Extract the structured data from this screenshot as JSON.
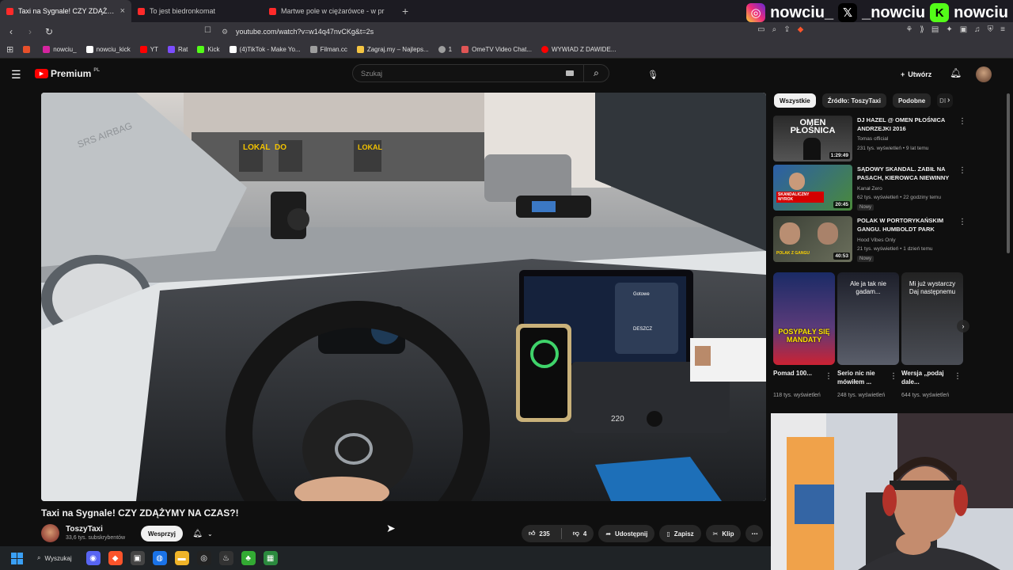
{
  "browser": {
    "tabs": [
      {
        "title": "Taxi na Sygnale! CZY ZDĄŻYM",
        "active": true
      },
      {
        "title": "To jest biedronkomat",
        "active": false
      },
      {
        "title": "Martwe pole w ciężarówce - w pr",
        "active": false
      }
    ],
    "close_glyph": "×",
    "new_tab_glyph": "+",
    "url": "youtube.com/watch?v=w14q47nvCKg&t=2s",
    "bookmarks": [
      {
        "label": "",
        "color": "#e8502b"
      },
      {
        "label": "nowciu_",
        "color": "#d6249f"
      },
      {
        "label": "nowciu_kick",
        "color": "#ffffff"
      },
      {
        "label": "YT",
        "color": "#ff0000"
      },
      {
        "label": "Rat",
        "color": "#7c4dff"
      },
      {
        "label": "Kick",
        "color": "#53fc18"
      },
      {
        "label": "(4)TikTok - Make Yo...",
        "color": "#ffffff"
      },
      {
        "label": "Filman.cc",
        "color": "#9e9e9e"
      },
      {
        "label": "Zagraj.my – Najleps...",
        "color": "#f5c542"
      },
      {
        "label": "1",
        "color": "#9e9e9e"
      },
      {
        "label": "OmeTV Video Chat...",
        "color": "#e05555"
      },
      {
        "label": "WYWIAD Z DAWIDE...",
        "color": "#ff0000"
      }
    ]
  },
  "socials": {
    "instagram": "nowciu_",
    "x": "_nowciu",
    "kick": "nowciu"
  },
  "youtube": {
    "logo_text": "Premium",
    "logo_region": "PL",
    "search_placeholder": "Szukaj",
    "create_label": "Utwórz"
  },
  "video": {
    "title": "Taxi na Sygnale! CZY ZDĄŻYMY NA CZAS?!",
    "channel": "ToszyTaxi",
    "subscribers": "33,6 tys. subskrybentów",
    "support_label": "Wesprzyj",
    "likes": "235",
    "dislikes": "4",
    "share_label": "Udostępnij",
    "save_label": "Zapisz",
    "clip_label": "Klip",
    "scene": {
      "shop_signs": [
        "LOKAL DO WYNAJĘCIA",
        "LOKAL DO WYNAJĘCIA"
      ],
      "screen_rain": "DESZCZ",
      "screen_ready": "Gotowe",
      "speedo": "220"
    }
  },
  "sidebar": {
    "chips": [
      "Wszystkie",
      "Źródło: ToszyTaxi",
      "Podobne",
      "Dl"
    ],
    "recommendations": [
      {
        "title": "DJ HAZEL @ OMEN PŁOŚNICA ANDRZEJKI 2016",
        "channel": "Tomas official",
        "meta": "231 tys. wyświetleń • 9 lat temu",
        "duration": "1:29:49",
        "badge": "",
        "thumb_text": "OMEN PŁOŚNICA"
      },
      {
        "title": "SĄDOWY SKANDAL. ZABIŁ NA PASACH, KIEROWCA NIEWINNY",
        "channel": "Kanał Zero",
        "meta": "62 tys. wyświetleń • 22 godziny temu",
        "duration": "20:45",
        "badge": "Nowy",
        "thumb_text": "SKANDALICZNY WYROK"
      },
      {
        "title": "POLAK W PORTORYKAŃSKIM GANGU. HUMBOLDT PARK",
        "channel": "Hood Vibes Only",
        "meta": "21 tys. wyświetleń • 1 dzień temu",
        "duration": "40:53",
        "badge": "Nowy",
        "thumb_text": "POLAK Z GANGU"
      }
    ],
    "shorts": [
      {
        "caption": "Pomad 100...",
        "views": "118 tys. wyświetleń",
        "thumb_text": "POSYPAŁY SIĘ MANDATY"
      },
      {
        "caption": "Serio nic nie mówiłem ...",
        "views": "248 tys. wyświetleń",
        "thumb_text": "Ale ja tak nie gadam..."
      },
      {
        "caption": "Wersja „podaj dale...",
        "views": "644 tys. wyświetleń",
        "thumb_text": "Mi już wystarczy Daj następnemu"
      }
    ]
  },
  "taskbar": {
    "search_label": "Wyszukaj"
  },
  "colors": {
    "bg": "#0f0f0f",
    "yt_red": "#ff0000",
    "chrome_dark": "#35343a"
  }
}
